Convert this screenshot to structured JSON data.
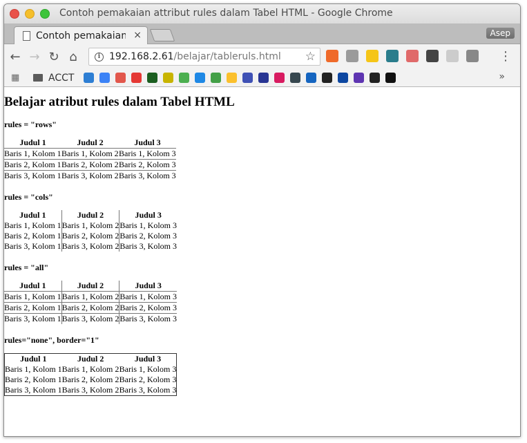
{
  "window": {
    "title": "Contoh pemakaian attribut rules dalam Tabel HTML - Google Chrome"
  },
  "tab": {
    "title": "Contoh pemakaian attribut rules dalam Tabel HTML",
    "close": "×"
  },
  "profile": {
    "name": "Asep"
  },
  "toolbar": {
    "back": "←",
    "forward": "→",
    "reload": "↻",
    "home": "⌂",
    "url_host": "192.168.2.61",
    "url_path": "/belajar/tableruls.html",
    "star": "☆",
    "menu": "⋮",
    "extensions": [
      {
        "name": "ext-orange",
        "color": "#ef6a2a"
      },
      {
        "name": "ext-gray",
        "color": "#9a9a9a"
      },
      {
        "name": "ext-m",
        "color": "#f5c518"
      },
      {
        "name": "ext-check",
        "color": "#2a7d8c"
      },
      {
        "name": "ext-eraser",
        "color": "#e06a6a"
      },
      {
        "name": "ext-crop",
        "color": "#444444"
      },
      {
        "name": "ext-circle",
        "color": "#cccccc"
      },
      {
        "name": "ext-camera",
        "color": "#888888"
      }
    ]
  },
  "bookmarks": {
    "folder_label": "ACCT",
    "more": "»",
    "colors": [
      "#2d7ed3",
      "#3b82f6",
      "#e2574c",
      "#e53935",
      "#1b5e20",
      "#c8b400",
      "#4caf50",
      "#1e88e5",
      "#43a047",
      "#fbc02d",
      "#3f51b5",
      "#283593",
      "#d81b60",
      "#37474f",
      "#1565c0",
      "#222222",
      "#0d47a1",
      "#5e35b1",
      "#222222",
      "#111111"
    ]
  },
  "page": {
    "heading": "Belajar atribut rules dalam Tabel HTML",
    "sections": [
      {
        "label": "rules = \"rows\""
      },
      {
        "label": "rules = \"cols\""
      },
      {
        "label": "rules = \"all\""
      },
      {
        "label": "rules=\"none\", border=\"1\""
      }
    ],
    "table": {
      "headers": [
        "Judul 1",
        "Judul 2",
        "Judul 3"
      ],
      "rows": [
        [
          "Baris 1, Kolom 1",
          "Baris 1, Kolom 2",
          "Baris 1, Kolom 3"
        ],
        [
          "Baris 2, Kolom 1",
          "Baris 2, Kolom 2",
          "Baris 2, Kolom 3"
        ],
        [
          "Baris 3, Kolom 1",
          "Baris 3, Kolom 2",
          "Baris 3, Kolom 3"
        ]
      ]
    }
  }
}
